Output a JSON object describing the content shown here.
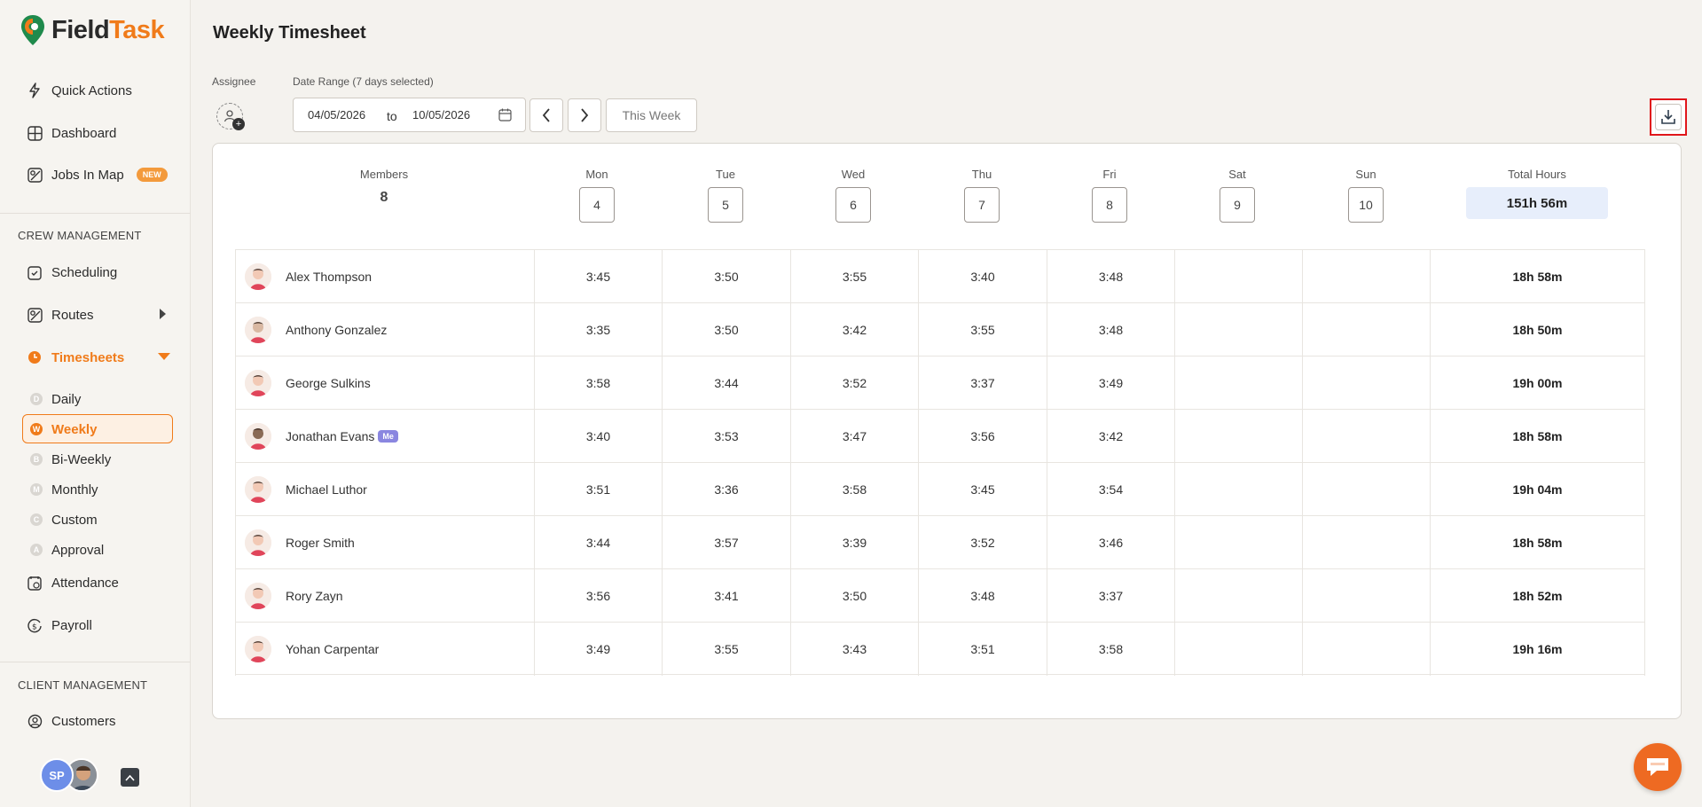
{
  "app": {
    "brand_part1": "Field",
    "brand_part2": "Task"
  },
  "sidebar": {
    "quick_actions": "Quick Actions",
    "dashboard": "Dashboard",
    "jobs_in_map": "Jobs In Map",
    "jobs_badge": "NEW",
    "crew_section": "CREW MANAGEMENT",
    "scheduling": "Scheduling",
    "routes": "Routes",
    "timesheets": "Timesheets",
    "sub_items": [
      {
        "letter": "D",
        "label": "Daily"
      },
      {
        "letter": "W",
        "label": "Weekly"
      },
      {
        "letter": "B",
        "label": "Bi-Weekly"
      },
      {
        "letter": "M",
        "label": "Monthly"
      },
      {
        "letter": "C",
        "label": "Custom"
      },
      {
        "letter": "A",
        "label": "Approval"
      }
    ],
    "attendance": "Attendance",
    "payroll": "Payroll",
    "client_section": "CLIENT MANAGEMENT",
    "customers": "Customers",
    "user_initials": "SP"
  },
  "header": {
    "title": "Weekly Timesheet",
    "assignee_label": "Assignee",
    "date_range_label": "Date Range (7 days selected)",
    "date_from": "04/05/2026",
    "date_to_word": "to",
    "date_to": "10/05/2026",
    "this_week": "This Week"
  },
  "table": {
    "members_label": "Members",
    "members_count": "8",
    "days": [
      {
        "name": "Mon",
        "num": "4"
      },
      {
        "name": "Tue",
        "num": "5"
      },
      {
        "name": "Wed",
        "num": "6"
      },
      {
        "name": "Thu",
        "num": "7"
      },
      {
        "name": "Fri",
        "num": "8"
      },
      {
        "name": "Sat",
        "num": "9"
      },
      {
        "name": "Sun",
        "num": "10"
      }
    ],
    "total_label": "Total Hours",
    "total_value": "151h 56m",
    "rows": [
      {
        "name": "Alex Thompson",
        "me": "",
        "hours": [
          "3:45",
          "3:50",
          "3:55",
          "3:40",
          "3:48",
          "",
          ""
        ],
        "total": "18h 58m"
      },
      {
        "name": "Anthony Gonzalez",
        "me": "",
        "hours": [
          "3:35",
          "3:50",
          "3:42",
          "3:55",
          "3:48",
          "",
          ""
        ],
        "total": "18h 50m"
      },
      {
        "name": "George Sulkins",
        "me": "",
        "hours": [
          "3:58",
          "3:44",
          "3:52",
          "3:37",
          "3:49",
          "",
          ""
        ],
        "total": "19h 00m"
      },
      {
        "name": "Jonathan Evans",
        "me": "Me",
        "hours": [
          "3:40",
          "3:53",
          "3:47",
          "3:56",
          "3:42",
          "",
          ""
        ],
        "total": "18h 58m"
      },
      {
        "name": "Michael Luthor",
        "me": "",
        "hours": [
          "3:51",
          "3:36",
          "3:58",
          "3:45",
          "3:54",
          "",
          ""
        ],
        "total": "19h 04m"
      },
      {
        "name": "Roger Smith",
        "me": "",
        "hours": [
          "3:44",
          "3:57",
          "3:39",
          "3:52",
          "3:46",
          "",
          ""
        ],
        "total": "18h 58m"
      },
      {
        "name": "Rory Zayn",
        "me": "",
        "hours": [
          "3:56",
          "3:41",
          "3:50",
          "3:48",
          "3:37",
          "",
          ""
        ],
        "total": "18h 52m"
      },
      {
        "name": "Yohan Carpentar",
        "me": "",
        "hours": [
          "3:49",
          "3:55",
          "3:43",
          "3:51",
          "3:58",
          "",
          ""
        ],
        "total": "19h 16m"
      }
    ]
  },
  "colors": {
    "accent": "#f07b1a",
    "highlight_border": "#e0161b",
    "total_bg": "#e7eefb"
  }
}
